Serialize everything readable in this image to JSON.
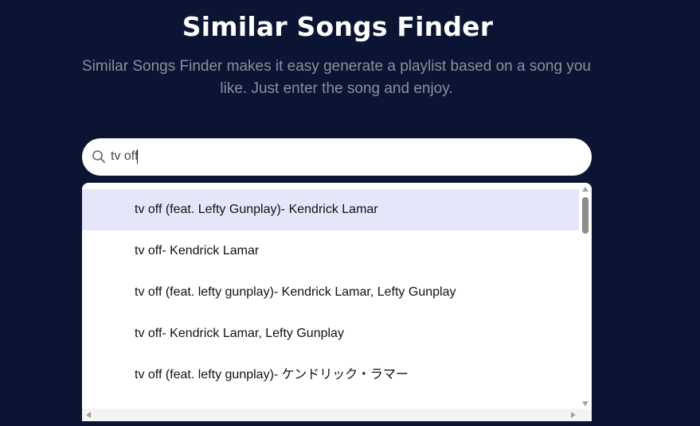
{
  "header": {
    "title": "Similar Songs Finder",
    "subtitle": "Similar Songs Finder makes it easy generate a playlist based on a song you like. Just enter the song and enjoy."
  },
  "search": {
    "icon": "search-icon",
    "value": "tv off",
    "placeholder": ""
  },
  "suggestions": [
    {
      "label": "tv off (feat. Lefty Gunplay)- Kendrick Lamar",
      "highlighted": true
    },
    {
      "label": "tv off- Kendrick Lamar",
      "highlighted": false
    },
    {
      "label": "tv off (feat. lefty gunplay)- Kendrick Lamar, Lefty Gunplay",
      "highlighted": false
    },
    {
      "label": "tv off- Kendrick Lamar, Lefty Gunplay",
      "highlighted": false
    },
    {
      "label": "tv off (feat. lefty gunplay)- ケンドリック・ラマー",
      "highlighted": false
    }
  ],
  "colors": {
    "background": "#0b1533",
    "title": "#ffffff",
    "subtitle": "#8a8f9e",
    "highlight": "#e6e6fb"
  }
}
